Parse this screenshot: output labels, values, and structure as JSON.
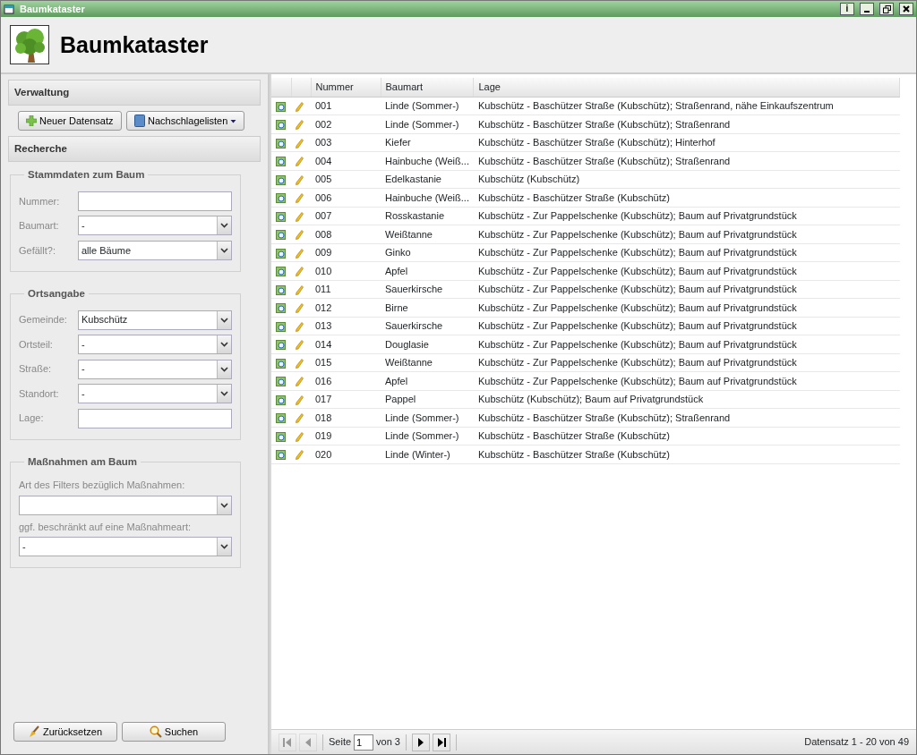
{
  "window": {
    "title": "Baumkataster",
    "info_button": "i"
  },
  "header": {
    "title": "Baumkataster"
  },
  "verwaltung": {
    "title": "Verwaltung",
    "buttons": [
      {
        "label": "Neuer Datensatz",
        "kind": "add"
      },
      {
        "label": "Nachschlagelisten",
        "kind": "menu"
      }
    ]
  },
  "recherche": {
    "title": "Recherche",
    "groups": [
      {
        "title": "Stammdaten zum Baum",
        "kind": "inline",
        "fields": [
          {
            "label": "Nummer:",
            "kind": "text"
          },
          {
            "label": "Baumart:",
            "kind": "select",
            "value": "-"
          },
          {
            "label": "Gefällt?:",
            "kind": "select",
            "value": "alle Bäume"
          }
        ]
      },
      {
        "title": "Ortsangabe",
        "kind": "inline",
        "fields": [
          {
            "label": "Gemeinde:",
            "kind": "select",
            "value": "Kubschütz"
          },
          {
            "label": "Ortsteil:",
            "kind": "select",
            "value": "-"
          },
          {
            "label": "Straße:",
            "kind": "select",
            "value": "-"
          },
          {
            "label": "Standort:",
            "kind": "select",
            "value": "-"
          },
          {
            "label": "Lage:",
            "kind": "text"
          }
        ]
      },
      {
        "title": "Maßnahmen am Baum",
        "kind": "stacked",
        "fields": [
          {
            "label": "Art des Filters bezüglich Maßnahmen:",
            "kind": "select"
          },
          {
            "label": "ggf. beschränkt auf eine Maßnahmeart:",
            "kind": "select",
            "value": "-"
          }
        ]
      }
    ],
    "buttons": [
      {
        "label": "Zurücksetzen",
        "kind": "reset"
      },
      {
        "label": "Suchen",
        "kind": "search"
      }
    ]
  },
  "table": {
    "columns": [
      "Nummer",
      "Baumart",
      "Lage"
    ],
    "rows": [
      {
        "nummer": "001",
        "baumart": "Linde (Sommer-)",
        "lage": "Kubschütz - Baschützer Straße (Kubschütz); Straßenrand, nähe Einkaufszentrum"
      },
      {
        "nummer": "002",
        "baumart": "Linde (Sommer-)",
        "lage": "Kubschütz - Baschützer Straße (Kubschütz); Straßenrand"
      },
      {
        "nummer": "003",
        "baumart": "Kiefer",
        "lage": "Kubschütz - Baschützer Straße (Kubschütz); Hinterhof"
      },
      {
        "nummer": "004",
        "baumart": "Hainbuche (Weiß...",
        "lage": "Kubschütz - Baschützer Straße (Kubschütz); Straßenrand"
      },
      {
        "nummer": "005",
        "baumart": "Edelkastanie",
        "lage": "Kubschütz (Kubschütz)"
      },
      {
        "nummer": "006",
        "baumart": "Hainbuche (Weiß...",
        "lage": "Kubschütz - Baschützer Straße (Kubschütz)"
      },
      {
        "nummer": "007",
        "baumart": "Rosskastanie",
        "lage": "Kubschütz - Zur Pappelschenke (Kubschütz); Baum auf Privatgrundstück"
      },
      {
        "nummer": "008",
        "baumart": "Weißtanne",
        "lage": "Kubschütz - Zur Pappelschenke (Kubschütz); Baum auf Privatgrundstück"
      },
      {
        "nummer": "009",
        "baumart": "Ginko",
        "lage": "Kubschütz - Zur Pappelschenke (Kubschütz); Baum auf Privatgrundstück"
      },
      {
        "nummer": "010",
        "baumart": "Apfel",
        "lage": "Kubschütz - Zur Pappelschenke (Kubschütz); Baum auf Privatgrundstück"
      },
      {
        "nummer": "011",
        "baumart": "Sauerkirsche",
        "lage": "Kubschütz - Zur Pappelschenke (Kubschütz); Baum auf Privatgrundstück"
      },
      {
        "nummer": "012",
        "baumart": "Birne",
        "lage": "Kubschütz - Zur Pappelschenke (Kubschütz); Baum auf Privatgrundstück"
      },
      {
        "nummer": "013",
        "baumart": "Sauerkirsche",
        "lage": "Kubschütz - Zur Pappelschenke (Kubschütz); Baum auf Privatgrundstück"
      },
      {
        "nummer": "014",
        "baumart": "Douglasie",
        "lage": "Kubschütz - Zur Pappelschenke (Kubschütz); Baum auf Privatgrundstück"
      },
      {
        "nummer": "015",
        "baumart": "Weißtanne",
        "lage": "Kubschütz - Zur Pappelschenke (Kubschütz); Baum auf Privatgrundstück"
      },
      {
        "nummer": "016",
        "baumart": "Apfel",
        "lage": "Kubschütz - Zur Pappelschenke (Kubschütz); Baum auf Privatgrundstück"
      },
      {
        "nummer": "017",
        "baumart": "Pappel",
        "lage": "Kubschütz (Kubschütz); Baum auf Privatgrundstück"
      },
      {
        "nummer": "018",
        "baumart": "Linde (Sommer-)",
        "lage": "Kubschütz - Baschützer Straße (Kubschütz); Straßenrand"
      },
      {
        "nummer": "019",
        "baumart": "Linde (Sommer-)",
        "lage": "Kubschütz - Baschützer Straße (Kubschütz)"
      },
      {
        "nummer": "020",
        "baumart": "Linde (Winter-)",
        "lage": "Kubschütz - Baschützer Straße (Kubschütz)"
      }
    ]
  },
  "pager": {
    "buttons": [
      {
        "kind": "first",
        "disabled": true
      },
      {
        "kind": "previous",
        "disabled": true
      },
      {
        "kind": "next",
        "disabled": false
      },
      {
        "kind": "last",
        "disabled": false
      }
    ],
    "page_label": "Seite",
    "page": "1",
    "of_label": "von 3",
    "summary": "Datensatz 1 - 20 von 49"
  }
}
